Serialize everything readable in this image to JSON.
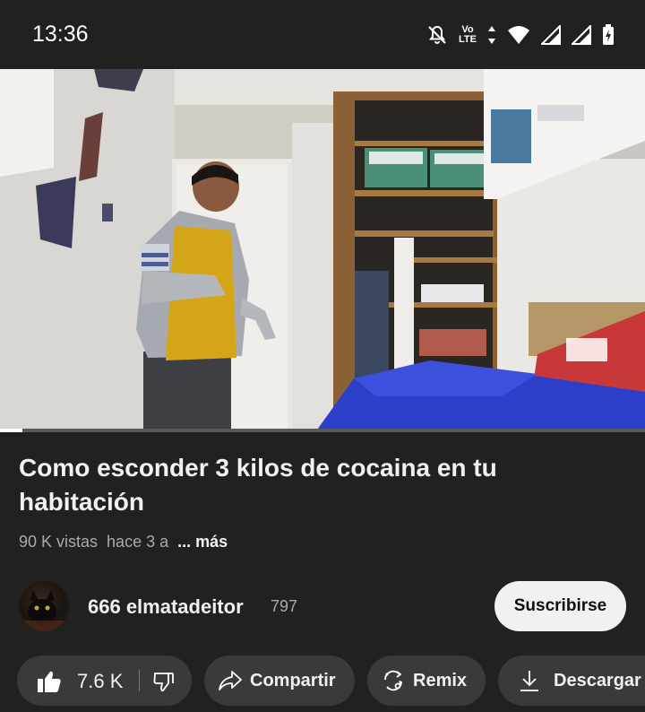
{
  "status_bar": {
    "time": "13:36",
    "icons": [
      "mute-bell-icon",
      "volte-icon",
      "data-arrows-icon",
      "wifi-icon",
      "signal-icon",
      "signal-icon",
      "battery-icon"
    ],
    "volte_line1": "Vo",
    "volte_line2": "LTE"
  },
  "video": {
    "progress_fraction": 0.035,
    "title": "Como esconder 3 kilos de cocaina en tu habitación",
    "views": "90 K vistas",
    "age": "hace 3 a",
    "more_label": "... más"
  },
  "channel": {
    "name": "666 elmatadeitor",
    "subscribers": "797",
    "subscribe_label": "Suscribirse"
  },
  "actions": {
    "like_count": "7.6 K",
    "share_label": "Compartir",
    "remix_label": "Remix",
    "download_label": "Descargar"
  },
  "colors": {
    "background": "#212121",
    "pill": "#3a3a3a",
    "subscribe_bg": "#f1f1f1"
  }
}
